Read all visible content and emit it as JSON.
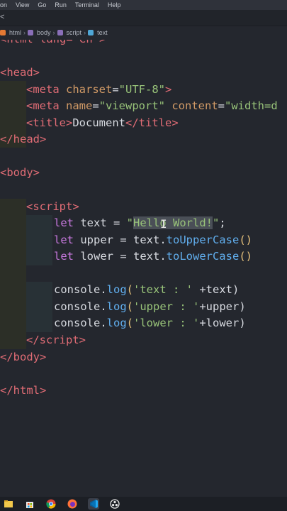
{
  "menu": [
    "on",
    "View",
    "Go",
    "Run",
    "Terminal",
    "Help"
  ],
  "breadcrumb": [
    "html",
    "body",
    "script",
    "text"
  ],
  "tab_chevron": "<",
  "code": {
    "l0": "<html lang=\"en\">",
    "l1_open": "<head",
    "l1_close": ">",
    "meta1_tag": "<meta",
    "meta1_attr": " charset",
    "meta1_eq": "=",
    "meta1_val": "\"UTF-8\"",
    "meta1_end": ">",
    "meta2_tag": "<meta",
    "meta2_attr1": " name",
    "meta2_eq1": "=",
    "meta2_val1": "\"viewport\"",
    "meta2_attr2": " content",
    "meta2_eq2": "=",
    "meta2_val2": "\"width=d",
    "title_open": "<title",
    "title_gt": ">",
    "title_text": "Document",
    "title_close": "</title",
    "title_end": ">",
    "head_close": "</head",
    "head_close_gt": ">",
    "body_open": "<body",
    "body_open_gt": ">",
    "script_open": "<script",
    "script_open_gt": ">",
    "let1_kw": "let",
    "let1_rest": " text = ",
    "let1_q1": "\"",
    "let1_sel": "Hello World!",
    "let1_q2": "\"",
    "let1_end": ";",
    "let2_kw": "let",
    "let2_rest": " upper = text.",
    "let2_fn": "toUpperCase",
    "let2_paren": "()",
    "let3_kw": "let",
    "let3_rest": " lower = text.",
    "let3_fn": "toLowerCase",
    "let3_paren": "()",
    "c1_pre": "console.",
    "c1_fn": "log",
    "c1_open": "(",
    "c1_str": "'text : '",
    "c1_rest": " +text)",
    "c2_pre": "console.",
    "c2_fn": "log",
    "c2_open": "(",
    "c2_str": "'upper : '",
    "c2_rest": "+upper)",
    "c3_pre": "console.",
    "c3_fn": "log",
    "c3_open": "(",
    "c3_str": "'lower : '",
    "c3_rest": "+lower)",
    "script_close": "</script",
    "script_close_gt": ">",
    "body_close": "</body",
    "body_close_gt": ">",
    "html_close": "</html",
    "html_close_gt": ">"
  },
  "cursor_glyph": "I",
  "taskbar_icons": [
    "file-explorer-icon",
    "store-icon",
    "chrome-icon",
    "firefox-icon",
    "vscode-icon",
    "obs-icon"
  ]
}
